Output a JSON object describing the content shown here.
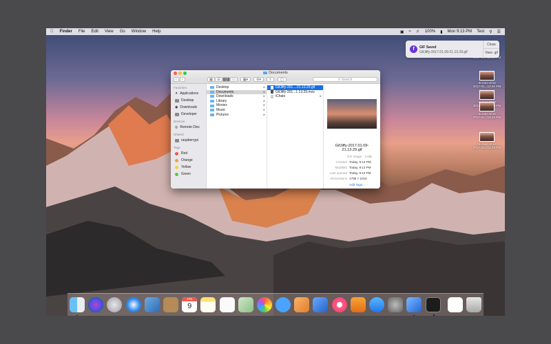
{
  "menubar": {
    "apple": "",
    "app_name": "Finder",
    "menus": [
      "File",
      "Edit",
      "View",
      "Go",
      "Window",
      "Help"
    ],
    "battery": "100%",
    "clock": "Mon 9:13 PM",
    "user": "Test"
  },
  "notification": {
    "title": "GIF Saved",
    "subtitle": "GifJiffy-2017.01.09-21.13.29.gif",
    "close": "Close",
    "view": "View .gif"
  },
  "desktop_icons": [
    {
      "label1": "Screen Shot",
      "label2": "2017-01...13.01 PM"
    },
    {
      "label1": "Screen Shot",
      "label2": "2017-01...13.28 PM"
    },
    {
      "label1": "Screen Shot",
      "label2": "2017-01...13.21 PM"
    },
    {
      "label1": "Screen Shot",
      "label2": "2017-01...13.28 PM"
    }
  ],
  "window": {
    "title": "Documents",
    "search_placeholder": "Search",
    "sidebar": {
      "favorites_header": "Favorites",
      "favorites": [
        "Applications",
        "Desktop",
        "Downloads",
        "Developer"
      ],
      "devices_header": "Devices",
      "devices": [
        "Remote Disc"
      ],
      "shared_header": "Shared",
      "shared": [
        "raspberrypi"
      ],
      "tags_header": "Tags",
      "tags": [
        {
          "name": "Red",
          "color": "#f05a4f"
        },
        {
          "name": "Orange",
          "color": "#f4a13a"
        },
        {
          "name": "Yellow",
          "color": "#f2d23c"
        },
        {
          "name": "Green",
          "color": "#5fc653"
        }
      ]
    },
    "col1": [
      "Desktop",
      "Documents",
      "Downloads",
      "Library",
      "Movies",
      "Music",
      "Pictures"
    ],
    "col2": [
      "GifJiffy-201...-21.13.29.gif",
      "GifJiffy-201...1.13.29.mov",
      "iChats"
    ],
    "preview": {
      "name": "GifJiffy-2017.01.09-21.13.29.gif",
      "kind": "GIF image - 3 MB",
      "meta": [
        {
          "k": "Created",
          "v": "Today, 9:13 PM"
        },
        {
          "k": "Modified",
          "v": "Today, 9:13 PM"
        },
        {
          "k": "Last opened",
          "v": "Today, 9:13 PM"
        },
        {
          "k": "Dimensions",
          "v": "1798 × 1010"
        }
      ],
      "add_tags": "Add Tags..."
    }
  },
  "calendar": {
    "month": "JAN",
    "day": "9"
  }
}
